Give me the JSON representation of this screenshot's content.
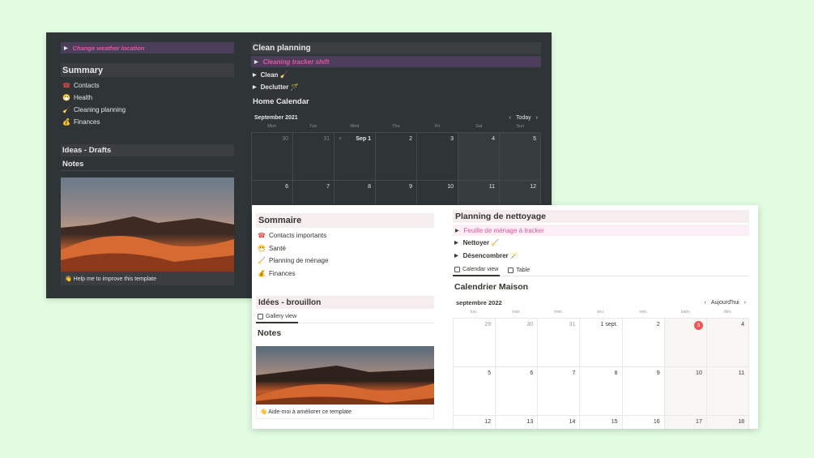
{
  "dark": {
    "weather_toggle": "Change weather location",
    "summary": {
      "title": "Summary",
      "items": [
        {
          "icon": "telephone-icon",
          "glyph": "☎",
          "label": "Contacts"
        },
        {
          "icon": "mask-face-icon",
          "glyph": "😷",
          "label": "Health"
        },
        {
          "icon": "broom-icon",
          "glyph": "🧹",
          "label": "Cleaning planning"
        },
        {
          "icon": "money-bag-icon",
          "glyph": "💰",
          "label": "Finances"
        }
      ]
    },
    "ideas_title": "Ideas - Drafts",
    "notes_title": "Notes",
    "photo_caption": "👋 Help me to improve this template",
    "clean": {
      "title": "Clean planning",
      "toggle_highlight": "Cleaning tracker shift",
      "toggles": [
        "Clean 🧹",
        "Declutter 🪄"
      ]
    },
    "calendar": {
      "title": "Home Calendar",
      "month": "September 2021",
      "today": "Today",
      "weekdays": [
        "Mon",
        "Tue",
        "Wed",
        "Thu",
        "Fri",
        "Sat",
        "Sun"
      ],
      "row1": [
        "30",
        "31",
        "Sep 1",
        "2",
        "3",
        "4",
        "5"
      ],
      "row2": [
        "6",
        "7",
        "8",
        "9",
        "10",
        "11",
        "12"
      ]
    },
    "colors": {
      "bg": "#2f3437",
      "accent": "#e255a1",
      "highlight": "#4a3e5a"
    }
  },
  "light": {
    "summary": {
      "title": "Sommaire",
      "items": [
        {
          "icon": "telephone-icon",
          "glyph": "☎",
          "label": "Contacts importants"
        },
        {
          "icon": "mask-face-icon",
          "glyph": "😷",
          "label": "Santé"
        },
        {
          "icon": "broom-icon",
          "glyph": "🧹",
          "label": "Planning de ménage"
        },
        {
          "icon": "money-bag-icon",
          "glyph": "💰",
          "label": "Finances"
        }
      ]
    },
    "ideas_title": "Idées - brouillon",
    "gallery_tab": "Gallery view",
    "notes_title": "Notes",
    "photo_caption": "👋 Aide-moi à améliorer ce template",
    "clean": {
      "title": "Planning de nettoyage",
      "toggle_highlight": "Feuille de ménage à tracker",
      "toggles": [
        "Nettoyer 🧹",
        "Désencombrer 🪄"
      ]
    },
    "tabs": [
      "Calendar view",
      "Table"
    ],
    "calendar": {
      "title": "Calendrier Maison",
      "month": "septembre 2022",
      "today": "Aujourd'hui",
      "weekdays": [
        "lun.",
        "mar.",
        "mer.",
        "jeu.",
        "ven.",
        "sam.",
        "dim."
      ],
      "row1": [
        "29",
        "30",
        "31",
        "1 sept.",
        "2",
        "3",
        "4"
      ],
      "row2": [
        "5",
        "6",
        "7",
        "8",
        "9",
        "10",
        "11"
      ],
      "row3": [
        "12",
        "13",
        "14",
        "15",
        "16",
        "17",
        "18"
      ],
      "today_value": "3"
    },
    "colors": {
      "accent": "#e255a1",
      "today": "#eb5757"
    }
  }
}
